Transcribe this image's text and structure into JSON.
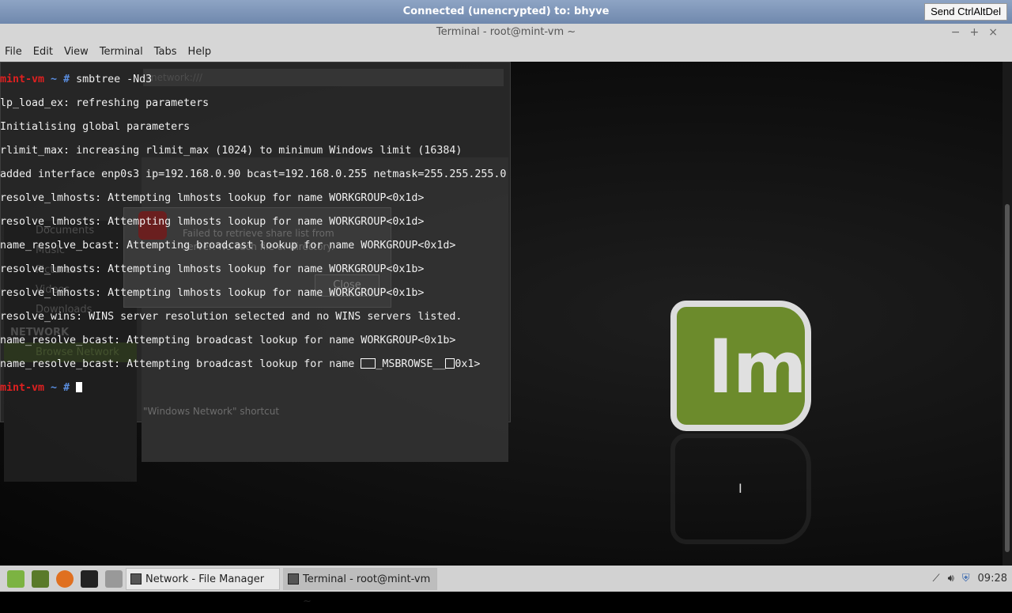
{
  "vnc": {
    "status": "Connected (unencrypted) to: bhyve",
    "send_button": "Send CtrlAltDel"
  },
  "window": {
    "title": "Terminal - root@mint-vm ~",
    "controls": [
      "−",
      "+",
      "×"
    ]
  },
  "menu": [
    "File",
    "Edit",
    "View",
    "Terminal",
    "Tabs",
    "Help"
  ],
  "terminal": {
    "prompt_host": "mint-vm",
    "prompt_path": " ~ #",
    "command": " smbtree -Nd3",
    "lines": [
      "lp_load_ex: refreshing parameters",
      "Initialising global parameters",
      "rlimit_max: increasing rlimit_max (1024) to minimum Windows limit (16384)",
      "added interface enp0s3 ip=192.168.0.90 bcast=192.168.0.255 netmask=255.255.255.0",
      "resolve_lmhosts: Attempting lmhosts lookup for name WORKGROUP<0x1d>",
      "resolve_lmhosts: Attempting lmhosts lookup for name WORKGROUP<0x1d>",
      "name_resolve_bcast: Attempting broadcast lookup for name WORKGROUP<0x1d>",
      "resolve_lmhosts: Attempting lmhosts lookup for name WORKGROUP<0x1b>",
      "resolve_lmhosts: Attempting lmhosts lookup for name WORKGROUP<0x1b>",
      "resolve_wins: WINS server resolution selected and no WINS servers listed.",
      "name_resolve_bcast: Attempting broadcast lookup for name WORKGROUP<0x1b>"
    ],
    "last_line": {
      "prefix": "name_resolve_bcast: Attempting broadcast lookup for name ",
      "middle": "_MSBROWSE__",
      "suffix": "0x1>"
    }
  },
  "file_manager": {
    "address": "network:///",
    "sidebar": [
      "Documents",
      "Music",
      "Pictures",
      "Videos",
      "Downloads"
    ],
    "network_header": "NETWORK",
    "network_item": "Browse Network",
    "status": "\"Windows Network\" shortcut",
    "dialog": {
      "message": "Failed to retrieve share list from server: No such file or directory.",
      "close": "Close"
    }
  },
  "taskbar": {
    "tasks": [
      {
        "label": "Network - File Manager"
      },
      {
        "label": "Terminal - root@mint-vm ~"
      }
    ],
    "clock": "09:28"
  }
}
